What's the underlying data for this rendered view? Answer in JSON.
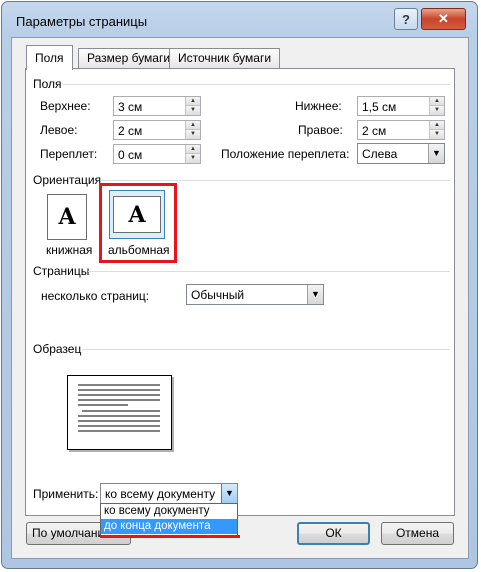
{
  "window": {
    "title": "Параметры страницы",
    "help_glyph": "?",
    "close_glyph": "✕"
  },
  "tabs": [
    "Поля",
    "Размер бумаги",
    "Источник бумаги"
  ],
  "margins": {
    "section": "Поля",
    "top_label": "Верхнее:",
    "top_value": "3 см",
    "bottom_label": "Нижнее:",
    "bottom_value": "1,5 см",
    "left_label": "Левое:",
    "left_value": "2 см",
    "right_label": "Правое:",
    "right_value": "2 см",
    "gutter_label": "Переплет:",
    "gutter_value": "0 см",
    "gutter_pos_label": "Положение переплета:",
    "gutter_pos_value": "Слева"
  },
  "orientation": {
    "section": "Ориентация",
    "portrait_label": "книжная",
    "landscape_label": "альбомная",
    "icon_letter": "A",
    "selected": "альбомная",
    "highlight_color": "#e8141b"
  },
  "pages": {
    "section": "Страницы",
    "multiple_label": "несколько страниц:",
    "multiple_value": "Обычный"
  },
  "preview": {
    "section": "Образец"
  },
  "apply": {
    "label": "Применить:",
    "value": "ко всему документу",
    "options": [
      "ко всему документу",
      "до конца документа"
    ],
    "highlighted_option": "до конца документа"
  },
  "buttons": {
    "default": "По умолчанию...",
    "ok": "ОК",
    "cancel": "Отмена"
  },
  "colors": {
    "selection": "#3399ff",
    "focus_ring": "#3c7fb1",
    "annotation": "#e8141b"
  }
}
